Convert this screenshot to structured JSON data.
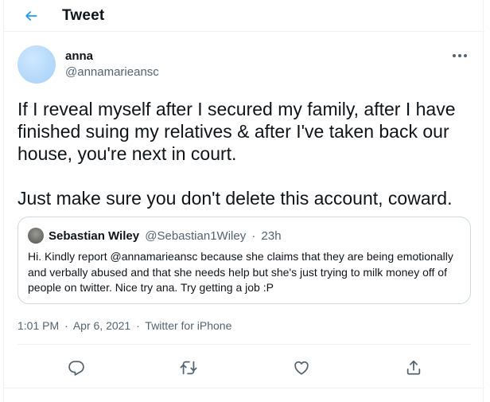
{
  "header": {
    "title": "Tweet",
    "back_icon": "arrow-left-icon"
  },
  "author": {
    "name": "anna",
    "handle": "@annamarieansc",
    "more_icon": "more-icon"
  },
  "tweet": {
    "text": "If I reveal myself after I secured my family, after I have finished suing my relatives & after I've taken back our house, you're next in court.\n\nJust make sure you don't delete this account, coward."
  },
  "quoted": {
    "name": "Sebastian Wiley",
    "handle": "@Sebastian1Wiley",
    "separator": "·",
    "time": "23h",
    "text": "Hi. Kindly report @annamarieansc because she claims that they are being emotionally and verbally abused and that she needs help but she's just trying to milk money off of people on twitter. Nice try ana. Try getting a job :P"
  },
  "meta": {
    "time": "1:01 PM",
    "separator": "·",
    "date": "Apr 6, 2021",
    "source": "Twitter for iPhone"
  },
  "actions": [
    {
      "icon": "reply-icon"
    },
    {
      "icon": "retweet-icon"
    },
    {
      "icon": "like-icon"
    },
    {
      "icon": "share-icon"
    }
  ],
  "colors": {
    "accent": "#1d9bf0",
    "text_primary": "#0f1419",
    "text_secondary": "#536471",
    "border": "#cfd9de",
    "divider": "#eff3f4"
  }
}
